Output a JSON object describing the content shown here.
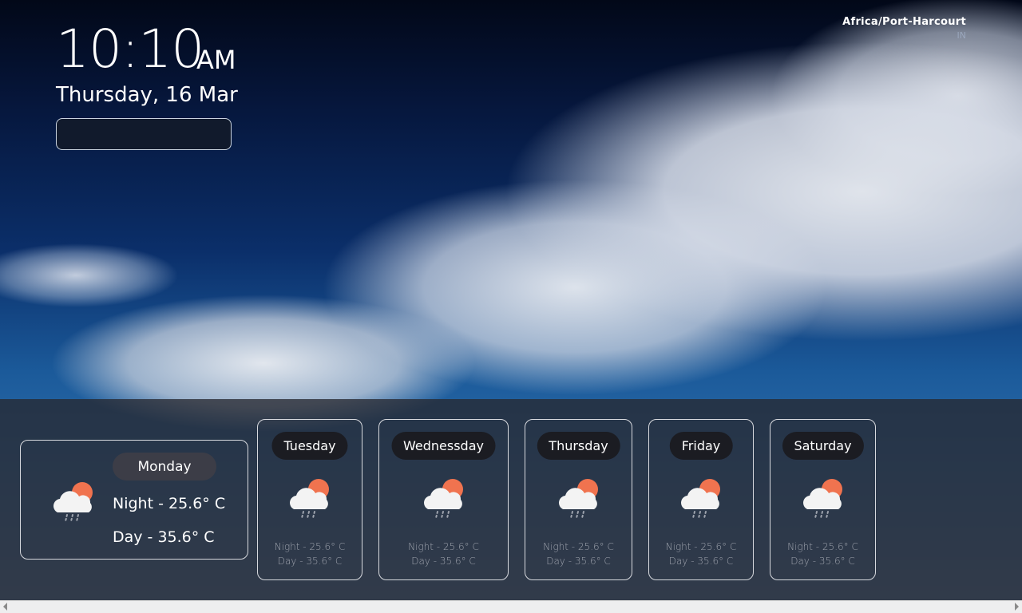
{
  "clock": {
    "time": "10:10",
    "ampm": "AM",
    "date": "Thursday, 16 Mar"
  },
  "timezone": {
    "name": "Africa/Port-Harcourt",
    "code": "IN"
  },
  "today": {
    "day": "Monday",
    "night": "Night - 25.6° C",
    "day_temp": "Day - 35.6° C",
    "icon": "cloud-sun-rain-icon"
  },
  "forecast": [
    {
      "day": "Tuesday",
      "night": "Night - 25.6° C",
      "day_temp": "Day - 35.6° C",
      "icon": "cloud-sun-rain-icon"
    },
    {
      "day": "Wednessday",
      "night": "Night - 25.6° C",
      "day_temp": "Day - 35.6° C",
      "icon": "cloud-sun-rain-icon"
    },
    {
      "day": "Thursday",
      "night": "Night - 25.6° C",
      "day_temp": "Day - 35.6° C",
      "icon": "cloud-sun-rain-icon"
    },
    {
      "day": "Friday",
      "night": "Night - 25.6° C",
      "day_temp": "Day - 35.6° C",
      "icon": "cloud-sun-rain-icon"
    },
    {
      "day": "Saturday",
      "night": "Night - 25.6° C",
      "day_temp": "Day - 35.6° C",
      "icon": "cloud-sun-rain-icon"
    }
  ],
  "colors": {
    "sun": "#f0734f",
    "cloud": "#f3f3f3",
    "rain": "#9ea3ad"
  }
}
